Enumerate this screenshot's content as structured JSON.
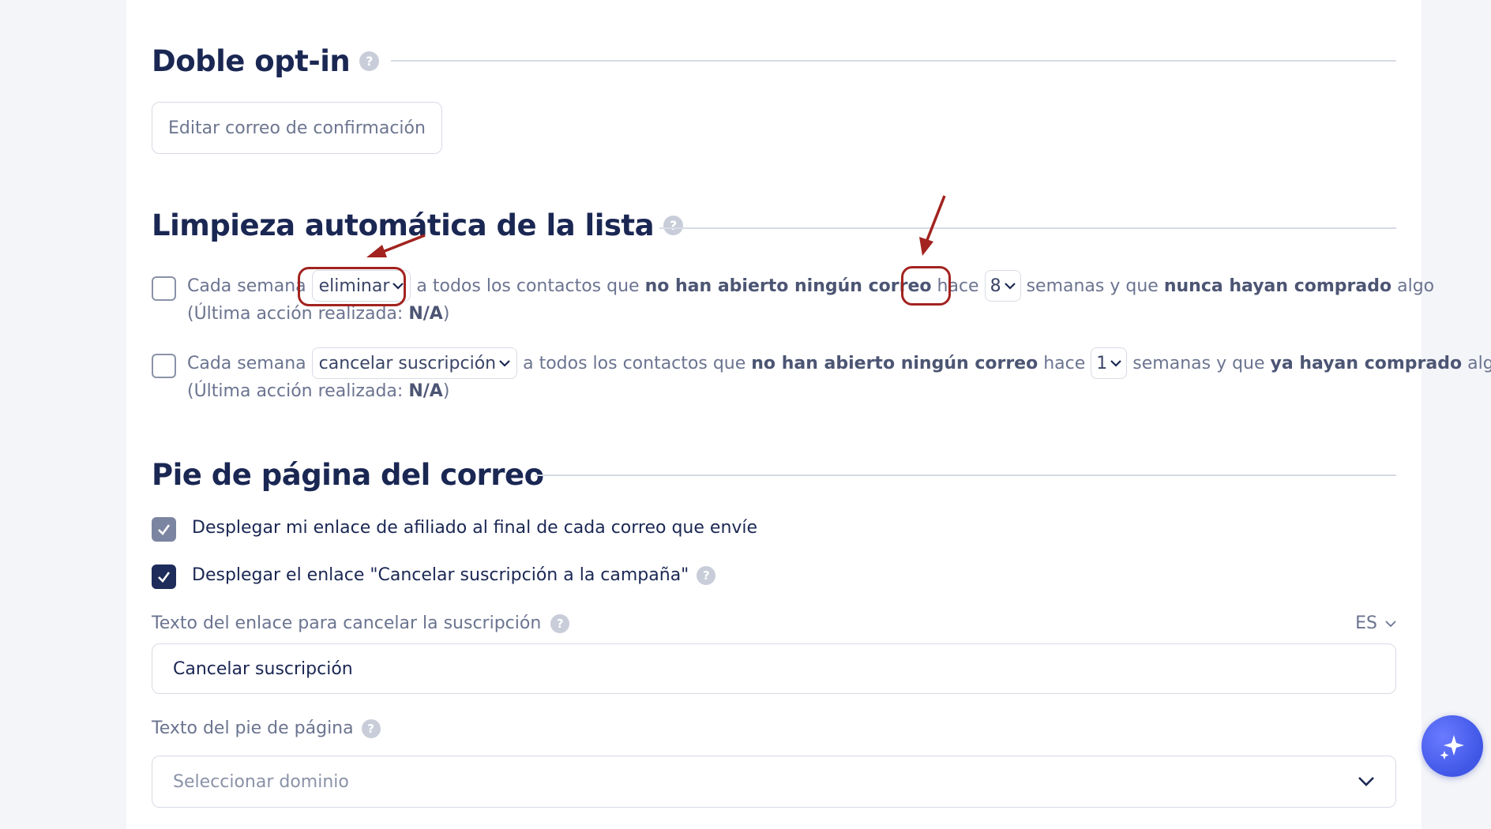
{
  "double_optin": {
    "title": "Doble opt-in",
    "help": "?",
    "edit_button": "Editar correo de confirmación"
  },
  "cleanup": {
    "title": "Limpieza automática de la lista",
    "help": "?",
    "rule1": {
      "prefix": "Cada semana",
      "action_value": "eliminar",
      "mid": "a todos los contactos que",
      "bold1": "no han abierto ningún correo",
      "hace": "hace",
      "weeks_value": "8",
      "weeks_text": "semanas y que",
      "bold2": "nunca hayan comprado",
      "suffix": "algo",
      "last_prefix": "(Última acción realizada:",
      "last_value": "N/A",
      "last_suffix": ")",
      "checked": false
    },
    "rule2": {
      "prefix": "Cada semana",
      "action_value": "cancelar suscripción",
      "mid": "a todos los contactos que",
      "bold1": "no han abierto ningún correo",
      "hace": "hace",
      "weeks_value": "1",
      "weeks_text": "semanas y que",
      "bold2": "ya hayan comprado",
      "suffix": "algo",
      "last_prefix": "(Última acción realizada:",
      "last_value": "N/A",
      "last_suffix": ")",
      "checked": false
    }
  },
  "footer": {
    "title": "Pie de página del correo",
    "option1": "Desplegar mi enlace de afiliado al final de cada correo que envíe",
    "option2": "Desplegar el enlace \"Cancelar suscripción a la campaña\"",
    "help": "?",
    "unsubscribe_label": "Texto del enlace para cancelar la suscripción",
    "language": "ES",
    "unsubscribe_value": "Cancelar suscripción",
    "footer_text_label": "Texto del pie de página",
    "domain_placeholder": "Seleccionar dominio"
  },
  "colors": {
    "annotation": "#a2231f",
    "navy": "#1a2753",
    "fab": "#4a5ef0"
  },
  "icons": [
    "help-icon",
    "chevron-down-icon",
    "check-icon",
    "sparkle-icon",
    "arrow-icon"
  ]
}
